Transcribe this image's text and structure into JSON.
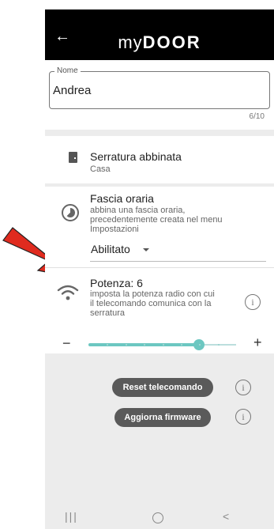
{
  "appbar": {
    "back_icon": "arrow-left-icon",
    "logo_prefix": "my",
    "logo_brand": "DOOR"
  },
  "name_field": {
    "label": "Nome",
    "value": "Andrea",
    "counter": "6/10"
  },
  "lock": {
    "icon": "door-icon",
    "title": "Serratura abbinata",
    "subtitle": "Casa"
  },
  "time_band": {
    "icon": "clock-icon",
    "title": "Fascia oraria",
    "description_lines": [
      "abbina una fascia oraria,",
      "precedentemente creata nel menu",
      "Impostazioni"
    ],
    "select_value": "Abilitato"
  },
  "power": {
    "icon": "wifi-icon",
    "title": "Potenza: 6",
    "description_lines": [
      "imposta la potenza radio con cui",
      "il telecomando comunica con la",
      "serratura"
    ],
    "minus": "−",
    "plus": "+",
    "level": 6,
    "max": 8
  },
  "actions": {
    "reset_label": "Reset telecomando",
    "firmware_label": "Aggiorna firmware"
  },
  "info_glyph": "i",
  "colors": {
    "accent": "#6cc7c1",
    "appbar": "#000000",
    "pill": "#5a5a5a",
    "arrow": "#e02b1f"
  }
}
